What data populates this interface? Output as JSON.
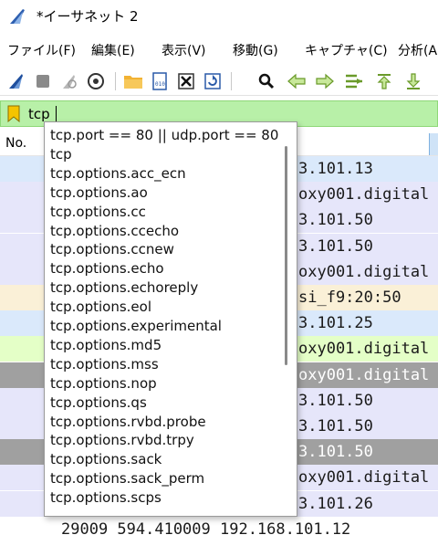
{
  "window": {
    "title": "*イーサネット 2"
  },
  "menu": [
    {
      "label": "ファイル(F)"
    },
    {
      "label": "編集(E)"
    },
    {
      "label": "表示(V)"
    },
    {
      "label": "移動(G)"
    },
    {
      "label": "キャプチャ(C)"
    },
    {
      "label": "分析(A"
    }
  ],
  "filter": {
    "value": "tcp"
  },
  "columns": {
    "no": "No."
  },
  "packet_rows": [
    {
      "text": "3.101.13",
      "bg": "#dae9fb"
    },
    {
      "text": "oxy001.digital",
      "bg": "#e6e6fa"
    },
    {
      "text": "3.101.50",
      "bg": "#e6e6fa"
    },
    {
      "text": "3.101.50",
      "bg": "#e6e6fa"
    },
    {
      "text": "oxy001.digital",
      "bg": "#e6e6fa"
    },
    {
      "text": "si_f9:20:50",
      "bg": "#faf0d7"
    },
    {
      "text": "3.101.25",
      "bg": "#dae9fb"
    },
    {
      "text": "oxy001.digital",
      "bg": "#e4ffc7"
    },
    {
      "text": "oxy001.digital",
      "bg": "#a0a0a0"
    },
    {
      "text": "3.101.50",
      "bg": "#e6e6fa"
    },
    {
      "text": "3.101.50",
      "bg": "#e6e6fa"
    },
    {
      "text": "3.101.50",
      "bg": "#a0a0a0"
    },
    {
      "text": "oxy001.digital",
      "bg": "#e6e6fa"
    },
    {
      "text": "3.101.26",
      "bg": "#e6e6fa"
    }
  ],
  "last_row": {
    "text": "29009 594.410009 192.168.101.12"
  },
  "autocomplete": [
    "tcp.port == 80 || udp.port == 80",
    "tcp",
    "tcp.options.acc_ecn",
    "tcp.options.ao",
    "tcp.options.cc",
    "tcp.options.ccecho",
    "tcp.options.ccnew",
    "tcp.options.echo",
    "tcp.options.echoreply",
    "tcp.options.eol",
    "tcp.options.experimental",
    "tcp.options.md5",
    "tcp.options.mss",
    "tcp.options.nop",
    "tcp.options.qs",
    "tcp.options.rvbd.probe",
    "tcp.options.rvbd.trpy",
    "tcp.options.sack",
    "tcp.options.sack_perm",
    "tcp.options.scps"
  ],
  "toolbar_icons": [
    "shark-fin-start-icon",
    "stop-square-icon",
    "restart-fin-icon",
    "options-gear-icon",
    "open-folder-icon",
    "save-file-icon",
    "close-file-icon",
    "reload-file-icon",
    "find-magnifier-icon",
    "go-back-arrow-icon",
    "go-forward-arrow-icon",
    "go-to-packet-icon",
    "first-packet-icon",
    "last-packet-icon"
  ]
}
